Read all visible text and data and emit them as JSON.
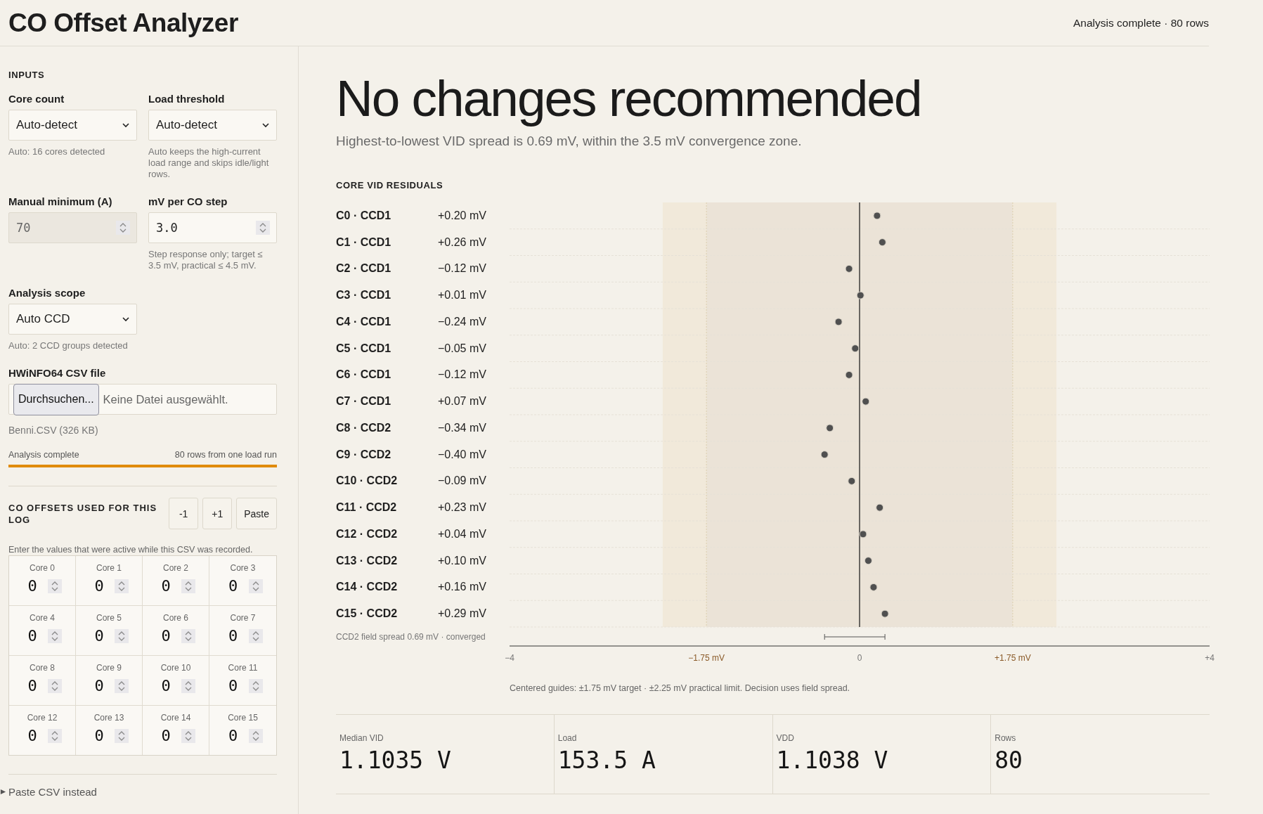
{
  "header": {
    "title": "CO Offset Analyzer",
    "status": "Analysis complete · 80 rows"
  },
  "inputs": {
    "heading": "INPUTS",
    "fields": [
      {
        "kind": "select",
        "label": "Core count",
        "value": "Auto-detect",
        "hint": "Auto: 16 cores detected"
      },
      {
        "kind": "select",
        "label": "Load threshold",
        "value": "Auto-detect",
        "hint": "Auto keeps the high-current load range and skips idle/light rows."
      },
      {
        "kind": "number",
        "label": "Manual minimum (A)",
        "value": "70",
        "disabled": true
      },
      {
        "kind": "number",
        "label": "mV per CO step",
        "value": "3.0",
        "disabled": false,
        "hint": "Step response only; target ≤ 3.5 mV, practical ≤ 4.5 mV."
      },
      {
        "kind": "select",
        "label": "Analysis scope",
        "value": "Auto CCD",
        "hint": "Auto: 2 CCD groups detected"
      },
      {
        "kind": "file",
        "label": "HWiNFO64 CSV file",
        "button": "Durchsuchen...",
        "value": "Keine Datei ausgewählt."
      }
    ],
    "file_info": "Benni.CSV (326 KB)",
    "progress": {
      "label": "Analysis complete",
      "detail": "80 rows from one load run",
      "level": 1
    }
  },
  "offsets": {
    "heading": "CO OFFSETS USED FOR THIS LOG",
    "buttons": [
      "-1",
      "+1",
      "Paste"
    ],
    "note": "Enter the values that were active while this CSV was recorded.",
    "cores": [
      {
        "label": "Core 0",
        "value": "0"
      },
      {
        "label": "Core 1",
        "value": "0"
      },
      {
        "label": "Core 2",
        "value": "0"
      },
      {
        "label": "Core 3",
        "value": "0"
      },
      {
        "label": "Core 4",
        "value": "0"
      },
      {
        "label": "Core 5",
        "value": "0"
      },
      {
        "label": "Core 6",
        "value": "0"
      },
      {
        "label": "Core 7",
        "value": "0"
      },
      {
        "label": "Core 8",
        "value": "0"
      },
      {
        "label": "Core 9",
        "value": "0"
      },
      {
        "label": "Core 10",
        "value": "0"
      },
      {
        "label": "Core 11",
        "value": "0"
      },
      {
        "label": "Core 12",
        "value": "0"
      },
      {
        "label": "Core 13",
        "value": "0"
      },
      {
        "label": "Core 14",
        "value": "0"
      },
      {
        "label": "Core 15",
        "value": "0"
      }
    ]
  },
  "paste_csv": {
    "label": "Paste CSV instead",
    "expanded": false
  },
  "result": {
    "headline": "No changes recommended",
    "summary": "Highest-to-lowest VID spread is 0.69 mV, within the 3.5 mV convergence zone.",
    "chart_heading": "CORE VID RESIDUALS",
    "chart_data": {
      "type": "scatter",
      "orientation": "horizontal",
      "categories": [
        "C0 · CCD1",
        "C1 · CCD1",
        "C2 · CCD1",
        "C3 · CCD1",
        "C4 · CCD1",
        "C5 · CCD1",
        "C6 · CCD1",
        "C7 · CCD1",
        "C8 · CCD2",
        "C9 · CCD2",
        "C10 · CCD2",
        "C11 · CCD2",
        "C12 · CCD2",
        "C13 · CCD2",
        "C14 · CCD2",
        "C15 · CCD2"
      ],
      "values": [
        0.2,
        0.26,
        -0.12,
        0.01,
        -0.24,
        -0.05,
        -0.12,
        0.07,
        -0.34,
        -0.4,
        -0.09,
        0.23,
        0.04,
        0.1,
        0.16,
        0.29
      ],
      "value_labels": [
        "+0.20 mV",
        "+0.26 mV",
        "−0.12 mV",
        "+0.01 mV",
        "−0.24 mV",
        "−0.05 mV",
        "−0.12 mV",
        "+0.07 mV",
        "−0.34 mV",
        "−0.40 mV",
        "−0.09 mV",
        "+0.23 mV",
        "+0.04 mV",
        "+0.10 mV",
        "+0.16 mV",
        "+0.29 mV"
      ],
      "xlim": [
        -4,
        4
      ],
      "xticks": [
        {
          "value": -4,
          "label": "−4"
        },
        {
          "value": -1.75,
          "label": "−1.75 mV"
        },
        {
          "value": 0,
          "label": "0"
        },
        {
          "value": 1.75,
          "label": "+1.75 mV"
        },
        {
          "value": 4,
          "label": "+4"
        }
      ],
      "annotations": [
        {
          "text": "CCD2 field spread 0.69 mV · converged"
        }
      ]
    },
    "note": "Centered guides: ±1.75 mV target · ±2.25 mV practical limit. Decision uses field spread."
  },
  "stats": [
    {
      "label": "Median VID",
      "value": "1.1035 V"
    },
    {
      "label": "Load",
      "value": "153.5 A"
    },
    {
      "label": "VDD",
      "value": "1.1038 V"
    },
    {
      "label": "Rows",
      "value": "80"
    }
  ]
}
